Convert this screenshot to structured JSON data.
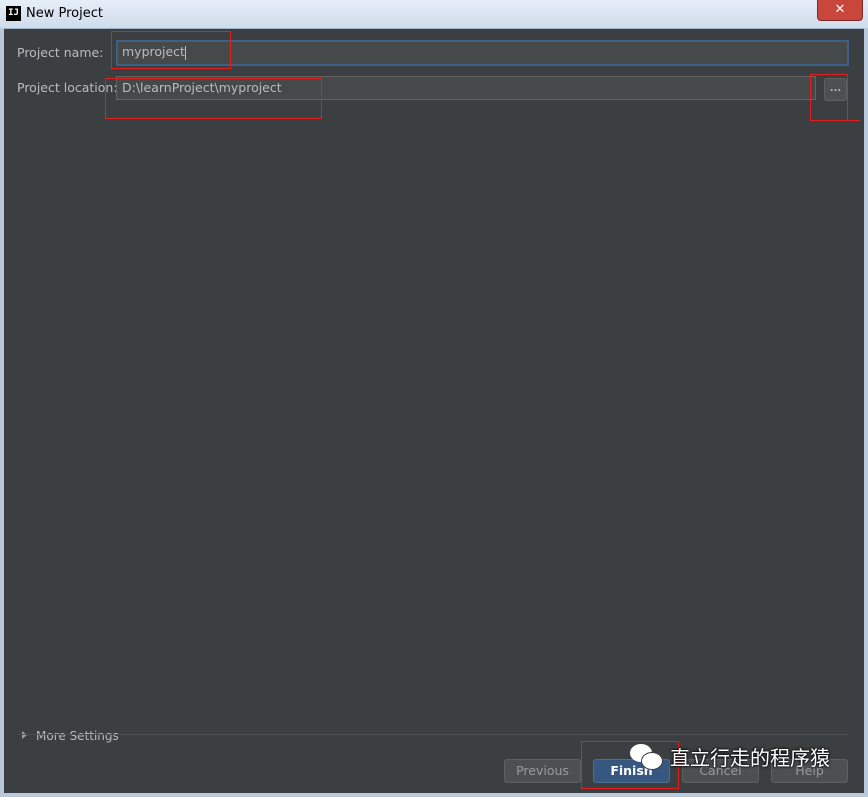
{
  "window": {
    "title": "New Project",
    "app_icon_text": "IJ",
    "close_glyph": "✕"
  },
  "form": {
    "name_label": "Project name:",
    "name_value": "myproject",
    "location_label": "Project location:",
    "location_value": "D:\\learnProject\\myproject",
    "browse_label": "..."
  },
  "footer": {
    "more_settings": "More Settings",
    "previous": "Previous",
    "finish": "Finish",
    "cancel": "Cancel",
    "help": "Help"
  },
  "watermark": {
    "text": "直立行走的程序猿",
    "icon": "wechat-icon"
  },
  "colors": {
    "dialog_bg": "#3c3f41",
    "annotation": "#e0201f",
    "primary_button": "#365880"
  }
}
